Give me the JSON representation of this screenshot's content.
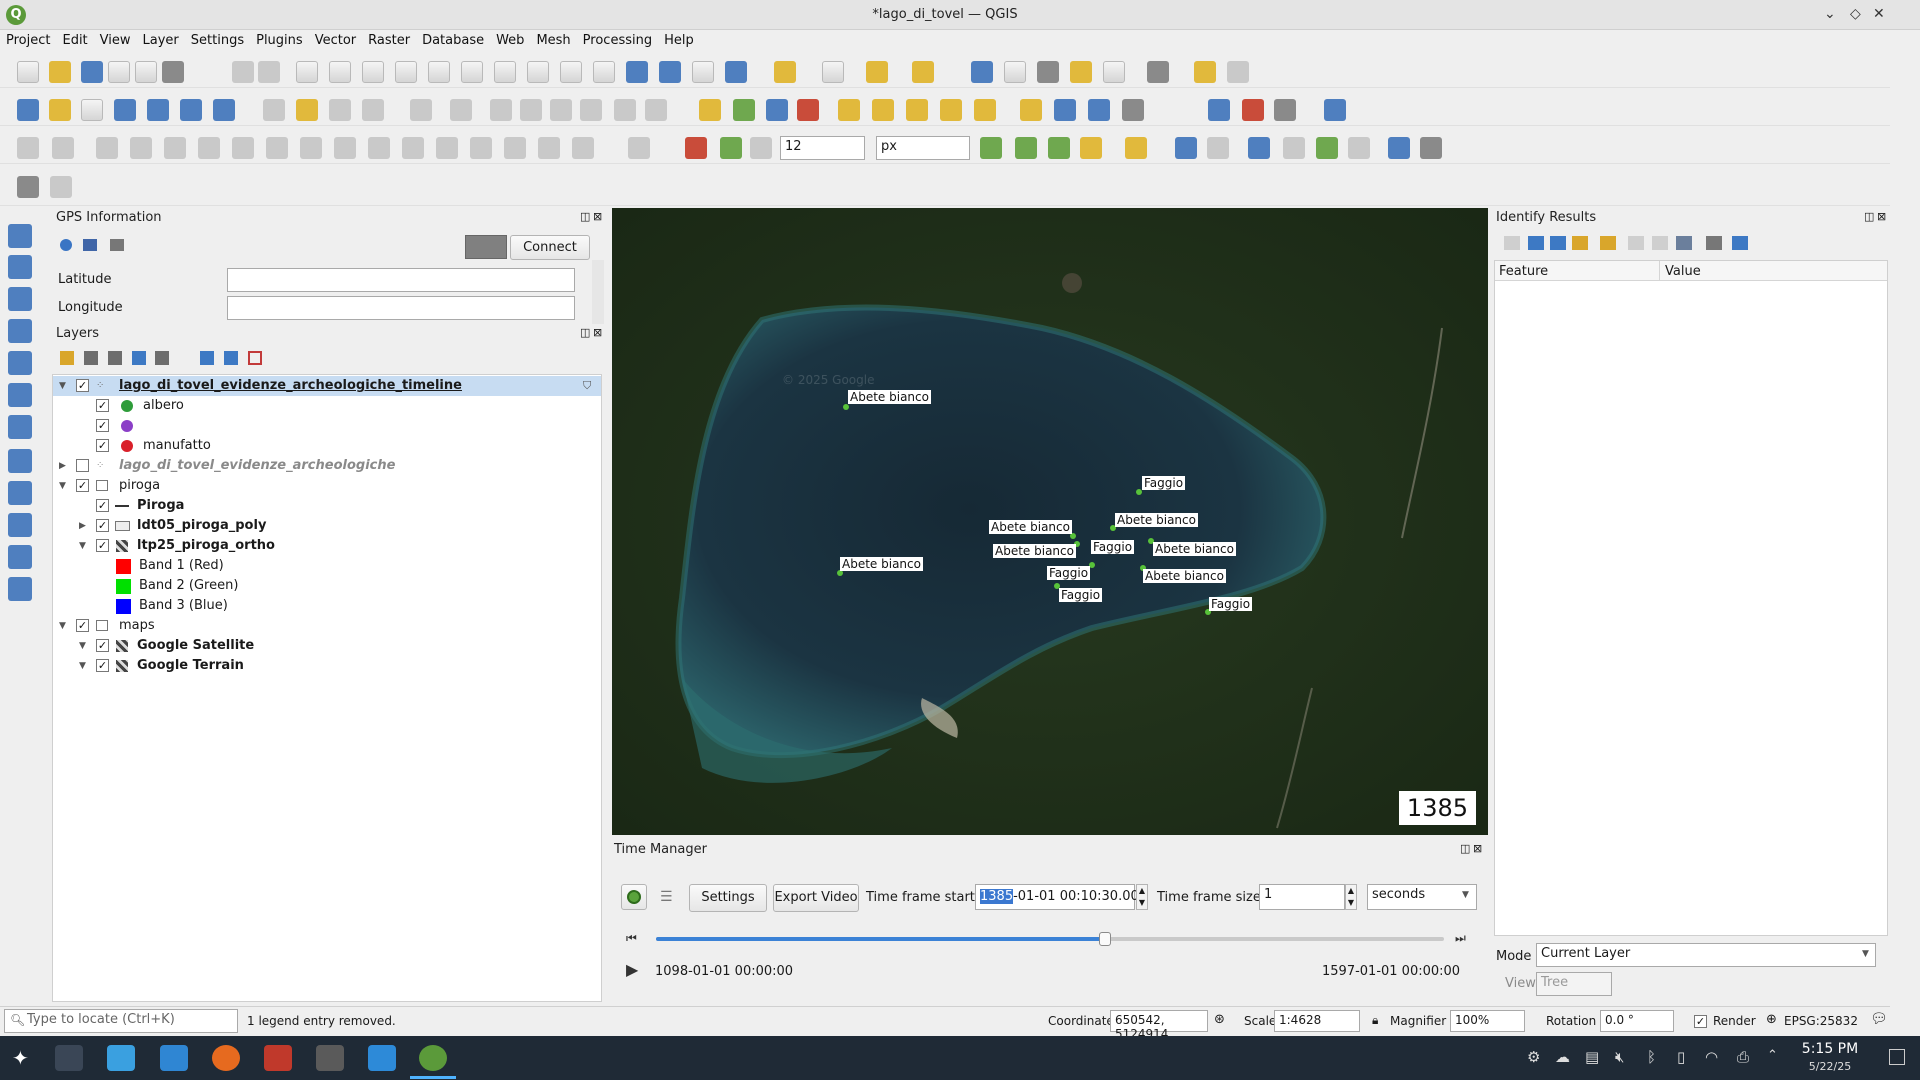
{
  "window": {
    "title": "*lago_di_tovel — QGIS",
    "app_icon": "Q"
  },
  "menu": [
    "Project",
    "Edit",
    "View",
    "Layer",
    "Settings",
    "Plugins",
    "Vector",
    "Raster",
    "Database",
    "Web",
    "Mesh",
    "Processing",
    "Help"
  ],
  "toolbar": {
    "snap_tolerance": "12",
    "snap_unit": "px"
  },
  "gps": {
    "title": "GPS Information",
    "connect_label": "Connect",
    "latitude_label": "Latitude",
    "longitude_label": "Longitude"
  },
  "layers": {
    "title": "Layers",
    "items": [
      {
        "label": "lago_di_tovel_evidenze_archeologiche_timeline"
      },
      {
        "label": "albero"
      },
      {
        "label": ""
      },
      {
        "label": "manufatto"
      },
      {
        "label": "lago_di_tovel_evidenze_archeologiche"
      },
      {
        "label": "piroga"
      },
      {
        "label": "Piroga"
      },
      {
        "label": "ldt05_piroga_poly"
      },
      {
        "label": "ltp25_piroga_ortho"
      },
      {
        "label": "Band 1 (Red)"
      },
      {
        "label": "Band 2 (Green)"
      },
      {
        "label": "Band 3 (Blue)"
      },
      {
        "label": "maps"
      },
      {
        "label": "Google Satellite"
      },
      {
        "label": "Google Terrain"
      }
    ]
  },
  "map": {
    "year": "1385",
    "watermark": "© 2025 Google",
    "labels": [
      {
        "text": "Abete bianco"
      },
      {
        "text": "Faggio"
      },
      {
        "text": "Abete bianco"
      },
      {
        "text": "Abete bianco"
      },
      {
        "text": "Faggio"
      },
      {
        "text": "Abete bianco"
      },
      {
        "text": "Abete bianco"
      },
      {
        "text": "Faggio"
      },
      {
        "text": "Abete bianco"
      },
      {
        "text": "Faggio"
      },
      {
        "text": "Abete bianco"
      }
    ]
  },
  "time_manager": {
    "title": "Time Manager",
    "settings_label": "Settings",
    "export_label": "Export Video",
    "frame_start_label": "Time frame start",
    "frame_start_highlight": "1385",
    "frame_start_rest": "-01-01 00:10:30.000",
    "frame_size_label": "Time frame size",
    "frame_size_value": "1",
    "frame_unit": "seconds",
    "range_start": "1098-01-01 00:00:00",
    "range_end": "1597-01-01 00:00:00",
    "slider_progress": 0.57
  },
  "identify": {
    "title": "Identify Results",
    "col_feature": "Feature",
    "col_value": "Value",
    "mode_label": "Mode",
    "mode_value": "Current Layer",
    "view_label": "View",
    "view_value": "Tree"
  },
  "status": {
    "locate_placeholder": "Type to locate (Ctrl+K)",
    "message": "1 legend entry removed.",
    "coordinate_label": "Coordinate",
    "coordinate_value": "650542, 5124914",
    "scale_label": "Scale",
    "scale_value": "1:4628",
    "magnifier_label": "Magnifier",
    "magnifier_value": "100%",
    "rotation_label": "Rotation",
    "rotation_value": "0.0 °",
    "render_label": "Render",
    "crs": "EPSG:25832"
  },
  "taskbar": {
    "time": "5:15 PM",
    "date": "5/22/25"
  },
  "colors": {
    "selection": "#c7dcf2",
    "albero": "#2e9c3a",
    "viola": "#8b3fc7",
    "manufatto": "#d9202a"
  }
}
